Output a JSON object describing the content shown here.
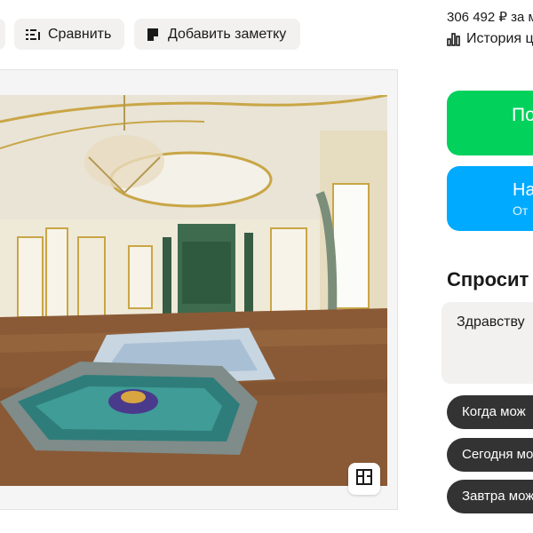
{
  "toolbar": {
    "compare_label": "Сравнить",
    "compare_icon": "compare-list-icon",
    "note_label": "Добавить заметку",
    "note_icon": "note-icon"
  },
  "gallery": {
    "plan_icon": "floor-plan-icon"
  },
  "sidebar": {
    "price": "306 492 ₽ за м",
    "history_label": "История ц",
    "history_icon": "bar-chart-icon",
    "primary_button_label": "По",
    "primary_button_color": "#02d15c",
    "secondary_button_label": "На",
    "secondary_button_sub": "От",
    "secondary_button_color": "#00aaff"
  },
  "ask": {
    "title": "Спросит",
    "message_value": "Здравству",
    "quick_replies": [
      "Когда мож",
      "Сегодня мо",
      "Завтра мож"
    ]
  }
}
